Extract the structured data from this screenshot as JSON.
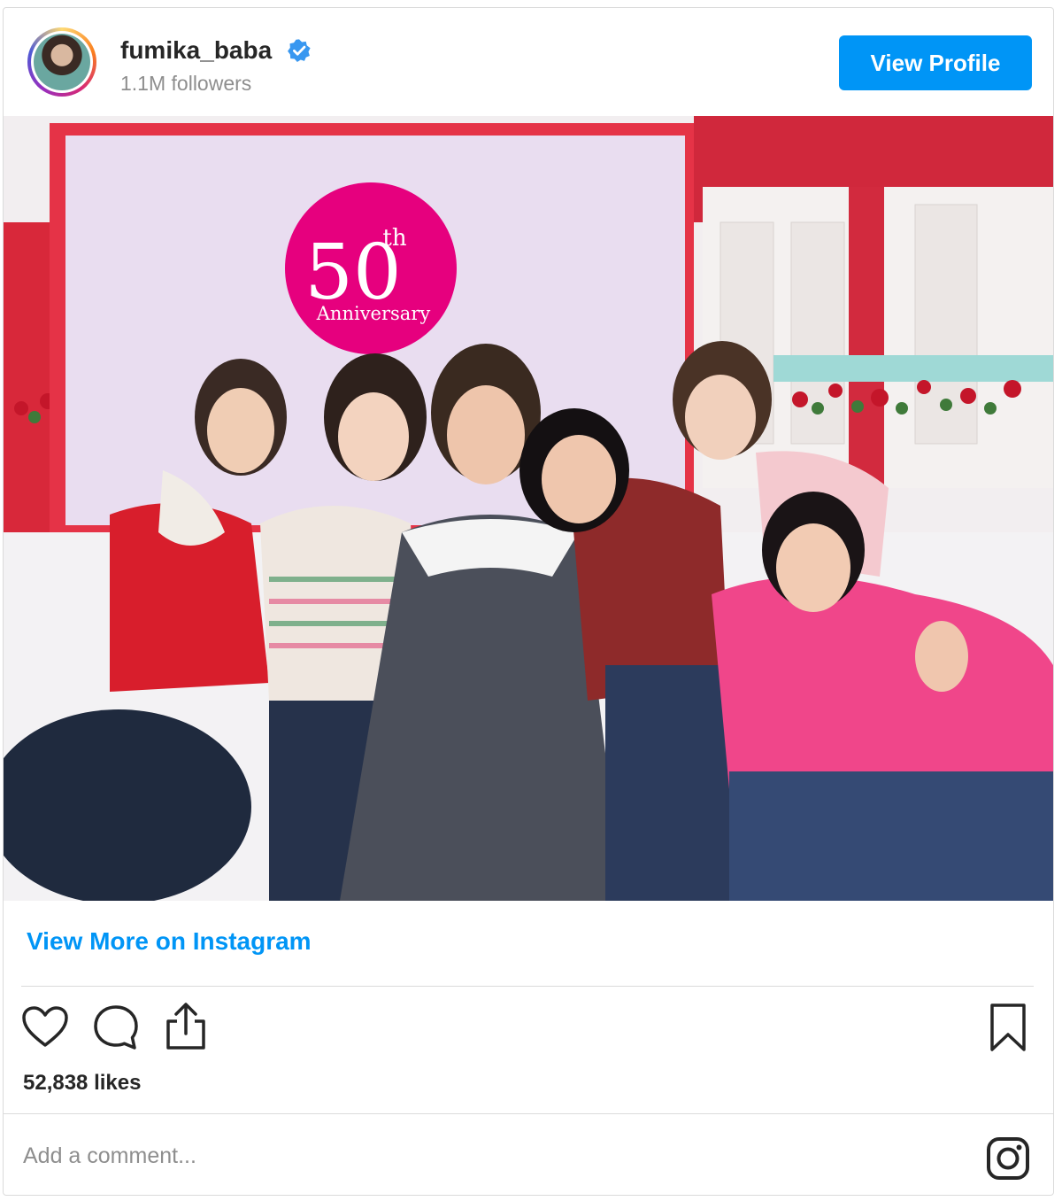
{
  "header": {
    "username": "fumika_baba",
    "followers": "1.1M followers",
    "view_profile_label": "View Profile"
  },
  "photo": {
    "badge_number": "50",
    "badge_suffix": "th",
    "badge_text": "Anniversary"
  },
  "links": {
    "view_more": "View More on Instagram"
  },
  "engagement": {
    "likes": "52,838 likes"
  },
  "comment": {
    "placeholder": "Add a comment..."
  },
  "icons": {
    "like": "heart-icon",
    "comment": "comment-icon",
    "share": "share-icon",
    "save": "bookmark-icon",
    "instagram": "instagram-logo-icon",
    "verified": "verified-badge-icon"
  },
  "colors": {
    "accent": "#0095f6",
    "badge": "#e6007e"
  }
}
